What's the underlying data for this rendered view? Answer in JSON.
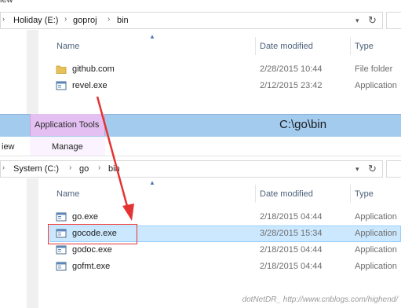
{
  "top_menu_fragment": "iew",
  "upper_window": {
    "address": {
      "segments": [
        "Holiday (E:)",
        "goproj",
        "bin"
      ]
    },
    "columns": {
      "name": "Name",
      "date_modified": "Date modified",
      "type": "Type"
    },
    "rows": [
      {
        "name": "github.com",
        "date": "2/28/2015 10:44",
        "type": "File folder",
        "icon": "folder-icon"
      },
      {
        "name": "revel.exe",
        "date": "2/12/2015 23:42",
        "type": "Application",
        "icon": "application-icon"
      }
    ]
  },
  "ribbon": {
    "context_tab": "Application Tools",
    "title": "C:\\go\\bin",
    "left_tab_fragment": "iew",
    "manage_tab": "Manage"
  },
  "lower_window": {
    "address": {
      "segments": [
        "System (C:)",
        "go",
        "bin"
      ]
    },
    "columns": {
      "name": "Name",
      "date_modified": "Date modified",
      "type": "Type"
    },
    "rows": [
      {
        "name": "go.exe",
        "date": "2/18/2015 04:44",
        "type": "Application",
        "icon": "application-icon",
        "selected": false
      },
      {
        "name": "gocode.exe",
        "date": "3/28/2015 15:34",
        "type": "Application",
        "icon": "application-icon",
        "selected": true
      },
      {
        "name": "godoc.exe",
        "date": "2/18/2015 04:44",
        "type": "Application",
        "icon": "application-icon",
        "selected": false
      },
      {
        "name": "gofmt.exe",
        "date": "2/18/2015 04:44",
        "type": "Application",
        "icon": "application-icon",
        "selected": false
      }
    ]
  },
  "watermark": "dotNetDR_ http://www.cnblogs.com/highend/",
  "colors": {
    "ribbon_bg": "#a3cbee",
    "context_tab_bg": "#e4c0f2",
    "selection_bg": "#cce8ff",
    "annotation": "#e53333"
  }
}
